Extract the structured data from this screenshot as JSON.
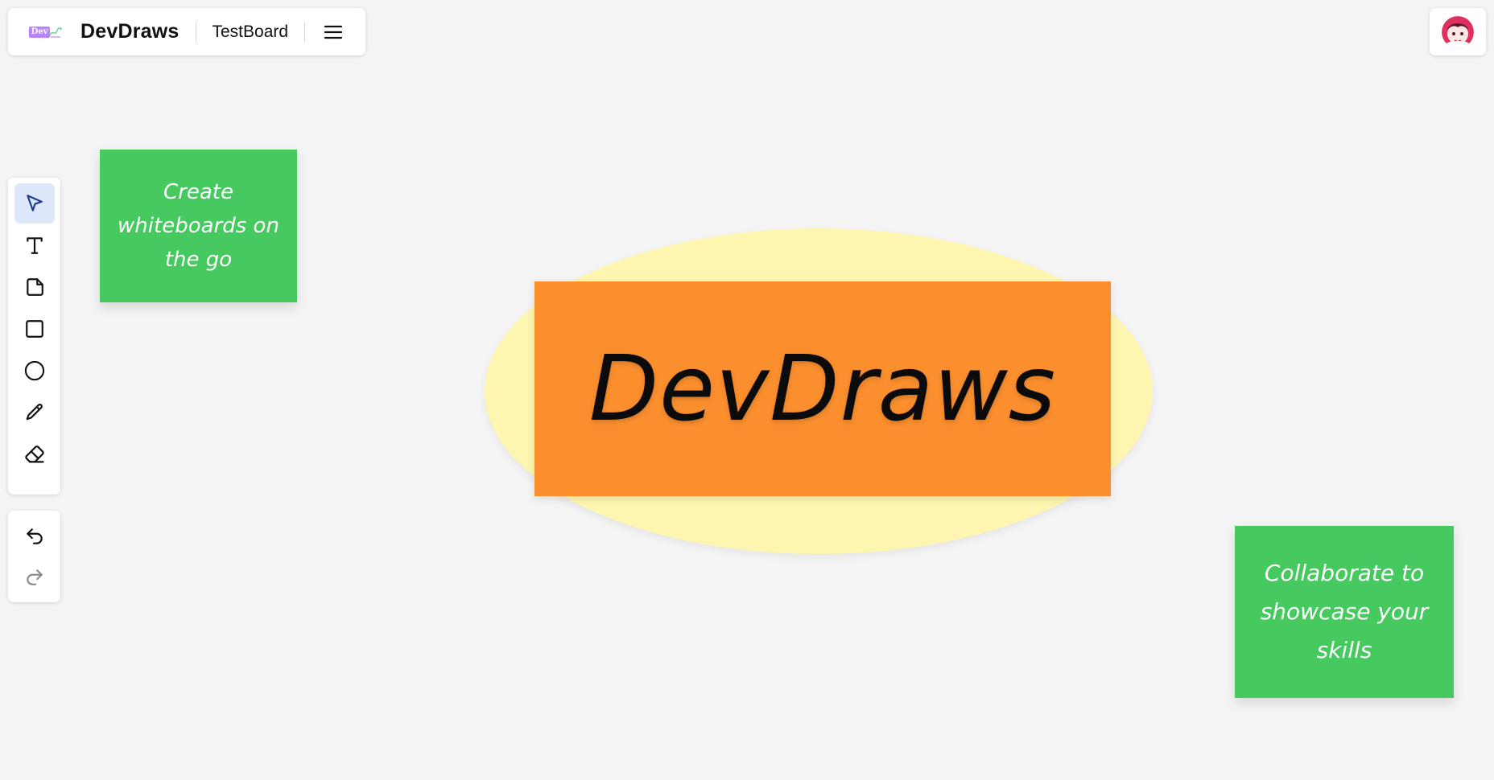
{
  "header": {
    "logo_text": "Dev",
    "app_name": "DevDraws",
    "board_name": "TestBoard"
  },
  "canvas": {
    "title_text": "DevDraws",
    "sticky_notes": [
      {
        "text": "Create whiteboards on the go"
      },
      {
        "text": "Collaborate to showcase your skills"
      }
    ],
    "colors": {
      "background": "#f4f4f4",
      "ellipse_fill": "#fef6b0",
      "title_rect_fill": "#fb8f2e",
      "sticky_fill": "#46c95f",
      "active_tool_bg": "#dde6fb",
      "active_tool_icon": "#1e3a8a"
    }
  },
  "toolbar": {
    "tools": [
      {
        "icon": "select-cursor-icon",
        "active": true
      },
      {
        "icon": "text-icon",
        "active": false
      },
      {
        "icon": "sticky-note-icon",
        "active": false
      },
      {
        "icon": "rectangle-icon",
        "active": false
      },
      {
        "icon": "ellipse-icon",
        "active": false
      },
      {
        "icon": "pencil-icon",
        "active": false
      },
      {
        "icon": "eraser-icon",
        "active": false
      }
    ],
    "history": [
      {
        "icon": "undo-icon",
        "enabled": true
      },
      {
        "icon": "redo-icon",
        "enabled": false
      }
    ]
  },
  "user": {
    "avatar_icon": "user-avatar"
  }
}
